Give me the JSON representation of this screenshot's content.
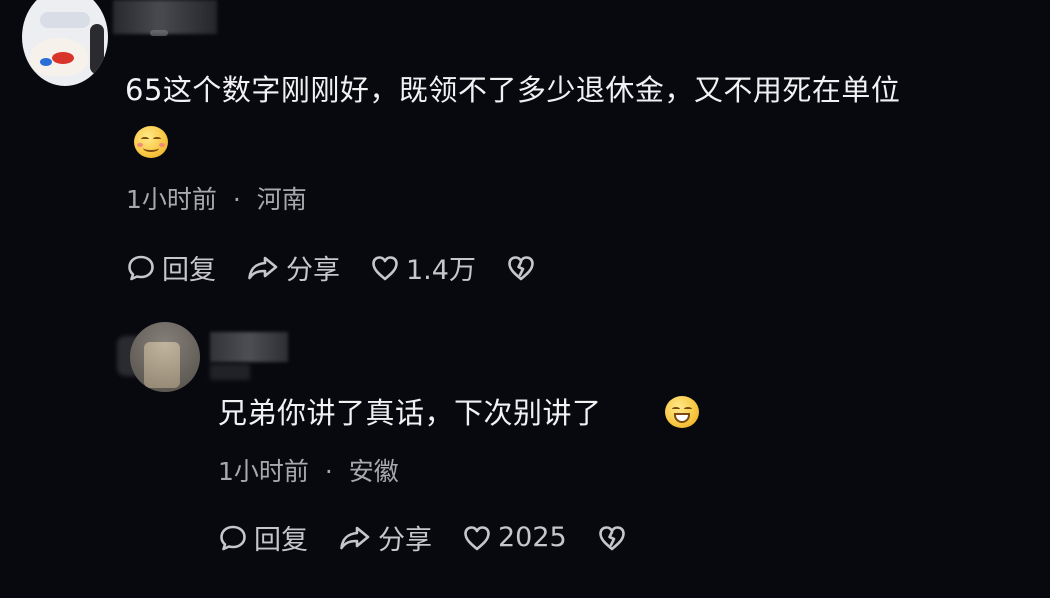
{
  "comments": [
    {
      "text": "65这个数字刚刚好，既领不了多少退休金，又不用死在单位",
      "emoji": "smiling-face-emoji",
      "time": "1小时前",
      "separator": "·",
      "location": "河南",
      "actions": {
        "reply_label": "回复",
        "share_label": "分享",
        "like_count": "1.4万"
      }
    },
    {
      "text": "兄弟你讲了真话，下次别讲了",
      "emoji": "grinning-face-emoji",
      "time": "1小时前",
      "separator": "·",
      "location": "安徽",
      "actions": {
        "reply_label": "回复",
        "share_label": "分享",
        "like_count": "2025"
      }
    }
  ],
  "icons": {
    "reply": "speech-bubble-icon",
    "share": "share-arrow-icon",
    "like": "heart-icon",
    "dislike": "broken-heart-icon"
  },
  "colors": {
    "background": "#08090e",
    "text": "#f1f1f4",
    "meta": "#a8a8ae",
    "action": "#c6c6cb"
  }
}
